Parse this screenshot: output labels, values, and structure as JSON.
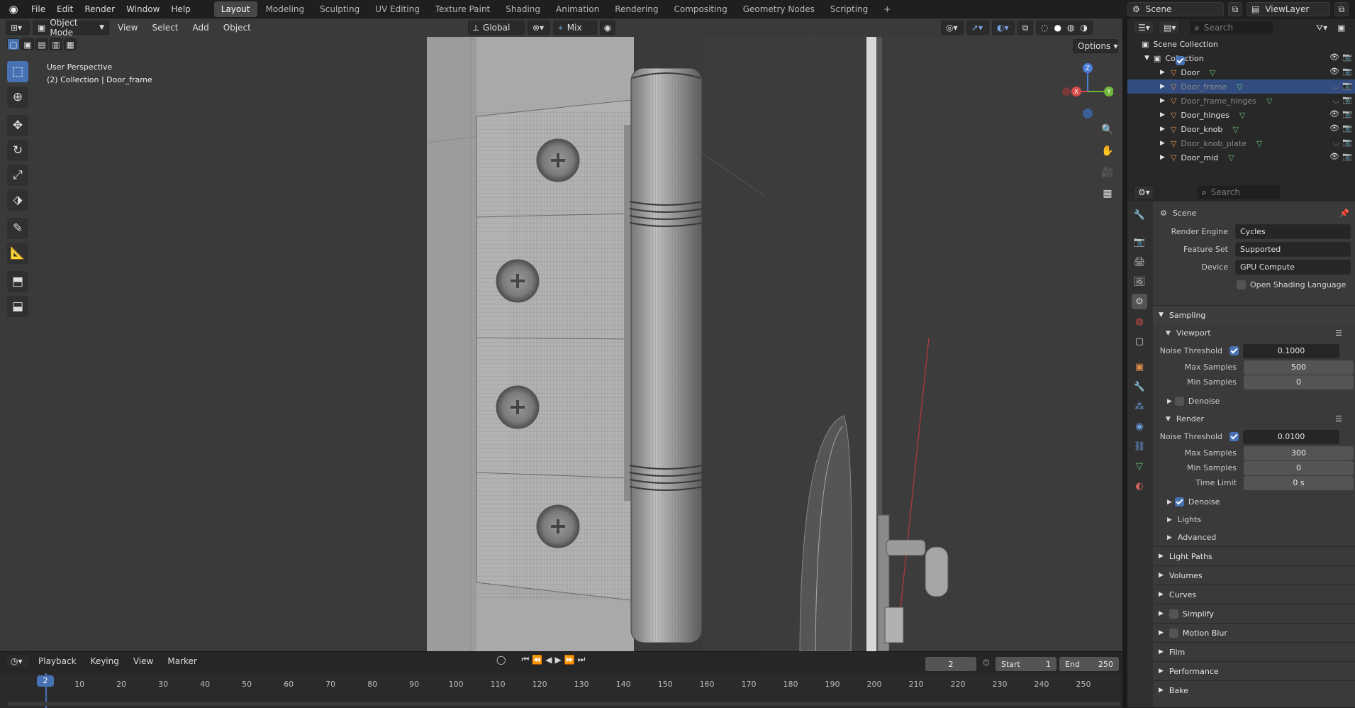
{
  "menu": [
    "File",
    "Edit",
    "Render",
    "Window",
    "Help"
  ],
  "workspaces": [
    "Layout",
    "Modeling",
    "Sculpting",
    "UV Editing",
    "Texture Paint",
    "Shading",
    "Animation",
    "Rendering",
    "Compositing",
    "Geometry Nodes",
    "Scripting"
  ],
  "add_tab": "+",
  "scene_name": "Scene",
  "view_layer": "ViewLayer",
  "viewport": {
    "mode": "Object Mode",
    "menus": [
      "View",
      "Select",
      "Add",
      "Object"
    ],
    "orientation": "Global",
    "snap_mode": "Mix",
    "options": "Options",
    "info_title": "User Perspective",
    "info_sub": "(2) Collection | Door_frame"
  },
  "outliner": {
    "search_placeholder": "Search",
    "scene_collection": "Scene Collection",
    "collection": "Collection",
    "objects": [
      {
        "name": "Door",
        "selected": false,
        "dim": false
      },
      {
        "name": "Door_frame",
        "selected": true,
        "dim": true
      },
      {
        "name": "Door_frame_hinges",
        "selected": false,
        "dim": true
      },
      {
        "name": "Door_hinges",
        "selected": false,
        "dim": false
      },
      {
        "name": "Door_knob",
        "selected": false,
        "dim": false
      },
      {
        "name": "Door_knob_plate",
        "selected": false,
        "dim": true
      },
      {
        "name": "Door_mid",
        "selected": false,
        "dim": false
      }
    ]
  },
  "properties": {
    "search_placeholder": "Search",
    "context": "Scene",
    "render_engine_label": "Render Engine",
    "render_engine": "Cycles",
    "feature_set_label": "Feature Set",
    "feature_set": "Supported",
    "device_label": "Device",
    "device": "GPU Compute",
    "osl_label": "Open Shading Language",
    "sampling": "Sampling",
    "viewport_sub": "Viewport",
    "noise_threshold_label": "Noise Threshold",
    "vp_noise": "0.1000",
    "max_samples_label": "Max Samples",
    "vp_max": "500",
    "min_samples_label": "Min Samples",
    "vp_min": "0",
    "denoise_label": "Denoise",
    "render_sub": "Render",
    "r_noise": "0.0100",
    "r_max": "300",
    "r_min": "0",
    "time_limit_label": "Time Limit",
    "r_time": "0 s",
    "lights": "Lights",
    "advanced": "Advanced",
    "sections": [
      "Light Paths",
      "Volumes",
      "Curves",
      "Simplify",
      "Motion Blur",
      "Film",
      "Performance",
      "Bake"
    ]
  },
  "timeline": {
    "menus": [
      "Playback",
      "Keying",
      "View",
      "Marker"
    ],
    "current_frame": "2",
    "start_label": "Start",
    "start": "1",
    "end_label": "End",
    "end": "250",
    "ticks": [
      "10",
      "20",
      "30",
      "40",
      "50",
      "60",
      "70",
      "80",
      "90",
      "100",
      "110",
      "120",
      "130",
      "140",
      "150",
      "160",
      "170",
      "180",
      "190",
      "200",
      "210",
      "220",
      "230",
      "240",
      "250"
    ],
    "playhead": "2"
  },
  "gizmo": {
    "x": "X",
    "y": "Y",
    "z": "Z"
  },
  "colors": {
    "accent": "#4772b3",
    "select": "#334d80",
    "object_orange": "#e08f4a",
    "mesh_green": "#62c27a"
  }
}
